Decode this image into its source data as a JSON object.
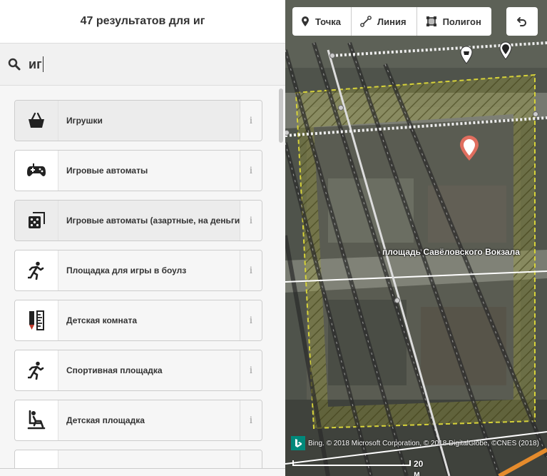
{
  "sidebar": {
    "header_title": "47 результатов для иг",
    "search": {
      "value": "иг",
      "placeholder": ""
    },
    "results": [
      {
        "label": "Игрушки",
        "icon": "shopping-basket-icon",
        "info": "i",
        "selected": true
      },
      {
        "label": "Игровые автоматы",
        "icon": "gamepad-icon",
        "info": "i"
      },
      {
        "label": "Игровые автоматы (азартные, на деньги)",
        "icon": "dice-icon",
        "info": "i",
        "selected": true
      },
      {
        "label": "Площадка для игры в боулз",
        "icon": "running-person-icon",
        "info": "i"
      },
      {
        "label": "Детская комната",
        "icon": "pencil-ruler-icon",
        "info": "i"
      },
      {
        "label": "Спортивная площадка",
        "icon": "running-person-icon",
        "info": "i"
      },
      {
        "label": "Детская площадка",
        "icon": "playground-icon",
        "info": "i"
      }
    ]
  },
  "map": {
    "toolbar": {
      "point_label": "Точка",
      "line_label": "Линия",
      "polygon_label": "Полигон"
    },
    "street_label": "площадь Савёловского Вокзала",
    "attribution": "Bing. © 2018 Microsoft Corporation, © 2018 DigitalGlobe, ©CNES (2018)",
    "scale_label": "20 м"
  },
  "colors": {
    "selected_pin": "#e06e5f",
    "area_outline": "#d6d23a",
    "accent_green": "#00897b"
  }
}
